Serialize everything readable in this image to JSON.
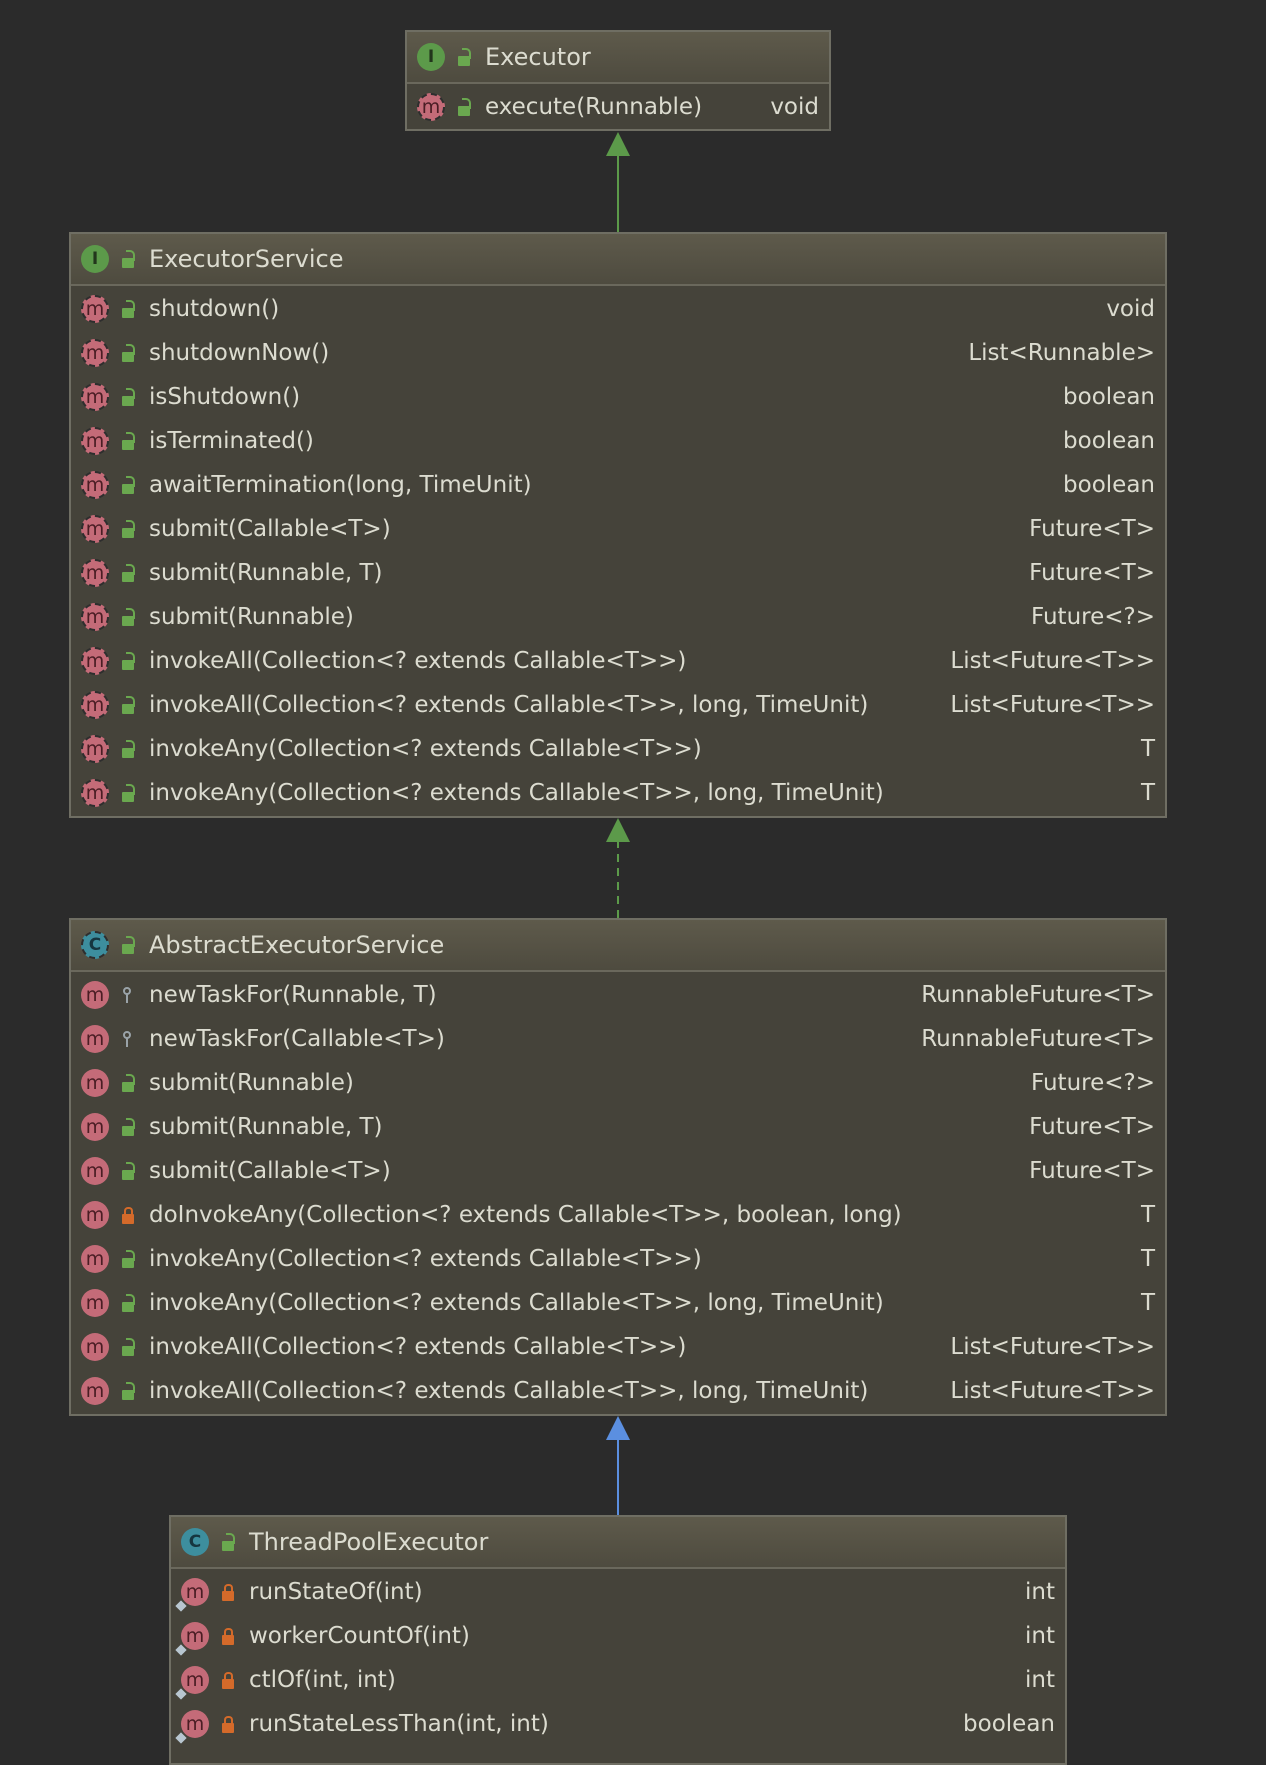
{
  "colors": {
    "background": "#2b2b2b",
    "box_fill": "#45433a",
    "header_fill": "#5e5a4b",
    "border": "#6f6e63",
    "text": "#dcdcd0",
    "interface_icon": "#5c9a4a",
    "class_icon": "#3d8e9e",
    "method_icon": "#c46b78",
    "extends_interface_arrow": "#5c9a4a",
    "extends_class_arrow": "#5b8fe0"
  },
  "diagram": {
    "executor": {
      "title": "Executor",
      "kind_label": "I",
      "methods": [
        {
          "name": "execute(Runnable)",
          "type": "void"
        }
      ]
    },
    "executor_service": {
      "title": "ExecutorService",
      "kind_label": "I",
      "methods": [
        {
          "name": "shutdown()",
          "type": "void"
        },
        {
          "name": "shutdownNow()",
          "type": "List<Runnable>"
        },
        {
          "name": "isShutdown()",
          "type": "boolean"
        },
        {
          "name": "isTerminated()",
          "type": "boolean"
        },
        {
          "name": "awaitTermination(long, TimeUnit)",
          "type": "boolean"
        },
        {
          "name": "submit(Callable<T>)",
          "type": "Future<T>"
        },
        {
          "name": "submit(Runnable, T)",
          "type": "Future<T>"
        },
        {
          "name": "submit(Runnable)",
          "type": "Future<?>"
        },
        {
          "name": "invokeAll(Collection<? extends Callable<T>>)",
          "type": "List<Future<T>>"
        },
        {
          "name": "invokeAll(Collection<? extends Callable<T>>, long, TimeUnit)",
          "type": "List<Future<T>>"
        },
        {
          "name": "invokeAny(Collection<? extends Callable<T>>)",
          "type": "T"
        },
        {
          "name": "invokeAny(Collection<? extends Callable<T>>, long, TimeUnit)",
          "type": "T"
        }
      ]
    },
    "abstract_executor_service": {
      "title": "AbstractExecutorService",
      "kind_label": "C",
      "methods": [
        {
          "name": "newTaskFor(Runnable, T)",
          "type": "RunnableFuture<T>"
        },
        {
          "name": "newTaskFor(Callable<T>)",
          "type": "RunnableFuture<T>"
        },
        {
          "name": "submit(Runnable)",
          "type": "Future<?>"
        },
        {
          "name": "submit(Runnable, T)",
          "type": "Future<T>"
        },
        {
          "name": "submit(Callable<T>)",
          "type": "Future<T>"
        },
        {
          "name": "doInvokeAny(Collection<? extends Callable<T>>, boolean, long)",
          "type": "T"
        },
        {
          "name": "invokeAny(Collection<? extends Callable<T>>)",
          "type": "T"
        },
        {
          "name": "invokeAny(Collection<? extends Callable<T>>, long, TimeUnit)",
          "type": "T"
        },
        {
          "name": "invokeAll(Collection<? extends Callable<T>>)",
          "type": "List<Future<T>>"
        },
        {
          "name": "invokeAll(Collection<? extends Callable<T>>, long, TimeUnit)",
          "type": "List<Future<T>>"
        }
      ]
    },
    "thread_pool_executor": {
      "title": "ThreadPoolExecutor",
      "kind_label": "C",
      "methods": [
        {
          "name": "runStateOf(int)",
          "type": "int"
        },
        {
          "name": "workerCountOf(int)",
          "type": "int"
        },
        {
          "name": "ctlOf(int, int)",
          "type": "int"
        },
        {
          "name": "runStateLessThan(int, int)",
          "type": "boolean"
        }
      ]
    }
  }
}
